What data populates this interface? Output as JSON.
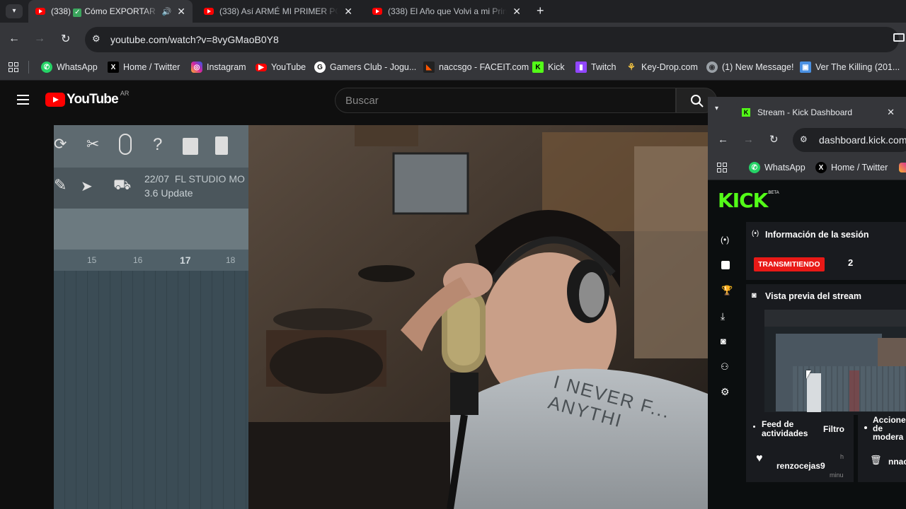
{
  "browser": {
    "tabs": [
      {
        "title": "(338)",
        "title2": "Cómo EXPORTAR",
        "active": true
      },
      {
        "title": "(338) Así ARMÉ MI PRIMER PC",
        "active": false
      },
      {
        "title": "(338) El Año que Volvi a mi Prin",
        "active": false
      }
    ],
    "url": "youtube.com/watch?v=8vyGMaoB0Y8",
    "bookmarks": [
      {
        "label": "WhatsApp",
        "icon": "whatsapp-icon",
        "color": "#25d366"
      },
      {
        "label": "Home / Twitter",
        "icon": "x-icon",
        "color": "#000000"
      },
      {
        "label": "Instagram",
        "icon": "instagram-icon",
        "color": "#d6249f"
      },
      {
        "label": "YouTube",
        "icon": "youtube-icon",
        "color": "#ff0000"
      },
      {
        "label": "Gamers Club - Jogu...",
        "icon": "gamersclub-icon",
        "color": "#ffffff"
      },
      {
        "label": "naccsgo - FACEIT.com",
        "icon": "faceit-icon",
        "color": "#ff5500"
      },
      {
        "label": "Kick",
        "icon": "kick-icon",
        "color": "#53fc18"
      },
      {
        "label": "Twitch",
        "icon": "twitch-icon",
        "color": "#9146ff"
      },
      {
        "label": "Key-Drop.com",
        "icon": "keydrop-icon",
        "color": "#f5c542"
      },
      {
        "label": "(1) New Message!",
        "icon": "globe-icon",
        "color": "#9aa0a6"
      },
      {
        "label": "Ver The Killing (201...",
        "icon": "tv-icon",
        "color": "#4a90e2"
      }
    ]
  },
  "youtube": {
    "logo_text": "YouTube",
    "country": "AR",
    "search_placeholder": "Buscar"
  },
  "video": {
    "fl_date": "22/07",
    "fl_title": "FL STUDIO MO",
    "fl_update": "3.6 Update",
    "fl_bars": [
      "15",
      "16",
      "17",
      "18"
    ],
    "shirt_text": "I NEVER F... ANYTHI"
  },
  "kick_window": {
    "tab_title": "Stream - Kick Dashboard",
    "url": "dashboard.kick.com",
    "bookmarks": [
      {
        "label": "WhatsApp",
        "icon": "whatsapp-icon"
      },
      {
        "label": "Home / Twitter",
        "icon": "x-icon"
      }
    ],
    "logo": "KICK",
    "beta": "BETA",
    "session_title": "Información de la sesión",
    "live_badge": "TRANSMITIENDO",
    "viewer_count": "2",
    "preview_title": "Vista previa del stream",
    "feed_title": "Feed de actividades",
    "filter_label": "Filtro",
    "mod_title": "Acciones de modera",
    "feed_user": "renzocejas9",
    "feed_time_top": "h",
    "feed_time_bottom": "minu",
    "mod_user": "nnac"
  }
}
